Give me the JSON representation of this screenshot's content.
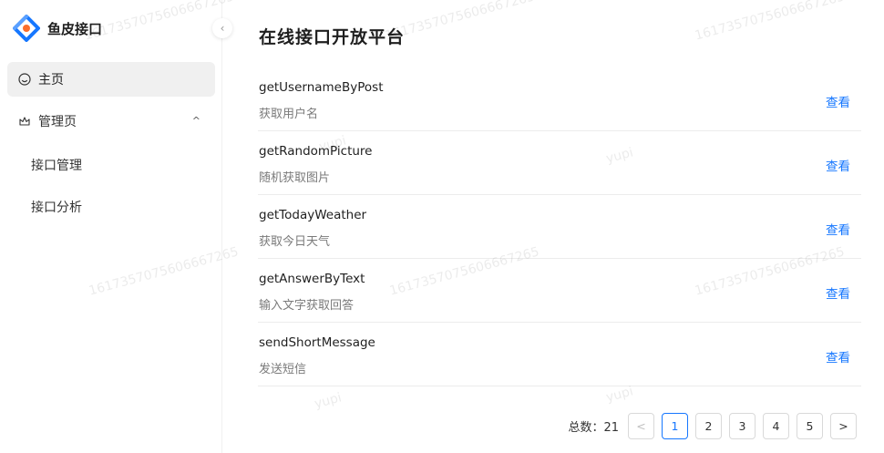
{
  "app": {
    "name": "鱼皮接口"
  },
  "sidebar": {
    "items": [
      {
        "label": "主页",
        "icon": "smile-icon",
        "active": true
      },
      {
        "label": "管理页",
        "icon": "crown-icon",
        "expanded": true,
        "children": [
          {
            "label": "接口管理"
          },
          {
            "label": "接口分析"
          }
        ]
      }
    ]
  },
  "main": {
    "title": "在线接口开放平台",
    "list": [
      {
        "name": "getUsernameByPost",
        "description": "获取用户名",
        "action": "查看"
      },
      {
        "name": "getRandomPicture",
        "description": "随机获取图片",
        "action": "查看"
      },
      {
        "name": "getTodayWeather",
        "description": "获取今日天气",
        "action": "查看"
      },
      {
        "name": "getAnswerByText",
        "description": "输入文字获取回答",
        "action": "查看"
      },
      {
        "name": "sendShortMessage",
        "description": "发送短信",
        "action": "查看"
      }
    ],
    "pagination": {
      "total_label": "总数：21",
      "pages": [
        "1",
        "2",
        "3",
        "4",
        "5"
      ],
      "current": "1",
      "prev": "<",
      "next": ">"
    }
  },
  "watermark": {
    "id_text": "1617357075606667265",
    "name_text": "yupi"
  },
  "colors": {
    "primary": "#1677ff",
    "logo_orange": "#fa6e2d",
    "logo_blue": "#1677ff"
  }
}
